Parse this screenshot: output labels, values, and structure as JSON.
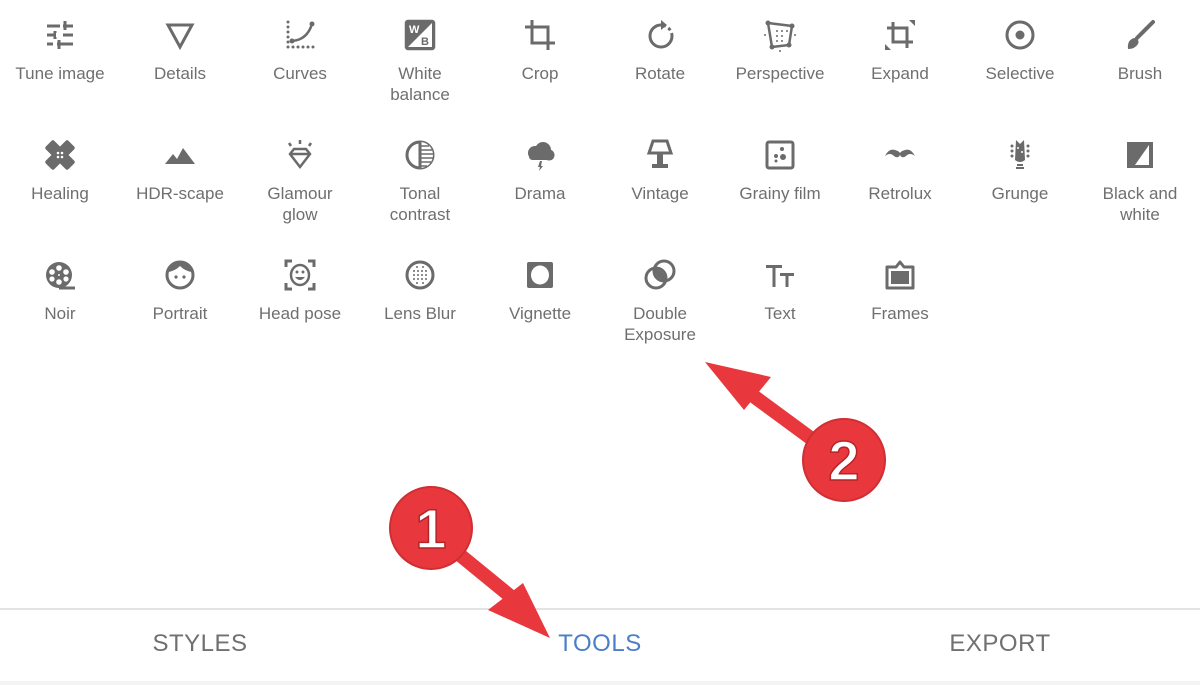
{
  "tools": [
    {
      "label": "Tune image",
      "icon": "tune-icon"
    },
    {
      "label": "Details",
      "icon": "details-icon"
    },
    {
      "label": "Curves",
      "icon": "curves-icon"
    },
    {
      "label": "White\nbalance",
      "icon": "white-balance-icon"
    },
    {
      "label": "Crop",
      "icon": "crop-icon"
    },
    {
      "label": "Rotate",
      "icon": "rotate-icon"
    },
    {
      "label": "Perspective",
      "icon": "perspective-icon"
    },
    {
      "label": "Expand",
      "icon": "expand-icon"
    },
    {
      "label": "Selective",
      "icon": "selective-icon"
    },
    {
      "label": "Brush",
      "icon": "brush-icon"
    },
    {
      "label": "Healing",
      "icon": "healing-icon"
    },
    {
      "label": "HDR-scape",
      "icon": "hdr-scape-icon"
    },
    {
      "label": "Glamour\nglow",
      "icon": "glamour-glow-icon"
    },
    {
      "label": "Tonal\ncontrast",
      "icon": "tonal-contrast-icon"
    },
    {
      "label": "Drama",
      "icon": "drama-icon"
    },
    {
      "label": "Vintage",
      "icon": "vintage-icon"
    },
    {
      "label": "Grainy film",
      "icon": "grainy-film-icon"
    },
    {
      "label": "Retrolux",
      "icon": "retrolux-icon"
    },
    {
      "label": "Grunge",
      "icon": "grunge-icon"
    },
    {
      "label": "Black and\nwhite",
      "icon": "black-and-white-icon"
    },
    {
      "label": "Noir",
      "icon": "noir-icon"
    },
    {
      "label": "Portrait",
      "icon": "portrait-icon"
    },
    {
      "label": "Head pose",
      "icon": "head-pose-icon"
    },
    {
      "label": "Lens Blur",
      "icon": "lens-blur-icon"
    },
    {
      "label": "Vignette",
      "icon": "vignette-icon"
    },
    {
      "label": "Double\nExposure",
      "icon": "double-exposure-icon"
    },
    {
      "label": "Text",
      "icon": "text-icon"
    },
    {
      "label": "Frames",
      "icon": "frames-icon"
    }
  ],
  "tabs": [
    {
      "label": "STYLES",
      "active": false
    },
    {
      "label": "TOOLS",
      "active": true
    },
    {
      "label": "EXPORT",
      "active": false
    }
  ],
  "annotations": [
    {
      "number": "1",
      "points_to": "TOOLS tab"
    },
    {
      "number": "2",
      "points_to": "Double Exposure tool"
    }
  ],
  "colors": {
    "icon": "#6b6b6b",
    "label": "#6f6f6f",
    "tab_active": "#4a7fc8",
    "tab_inactive": "#707070",
    "annotation_red": "#e8383d"
  }
}
